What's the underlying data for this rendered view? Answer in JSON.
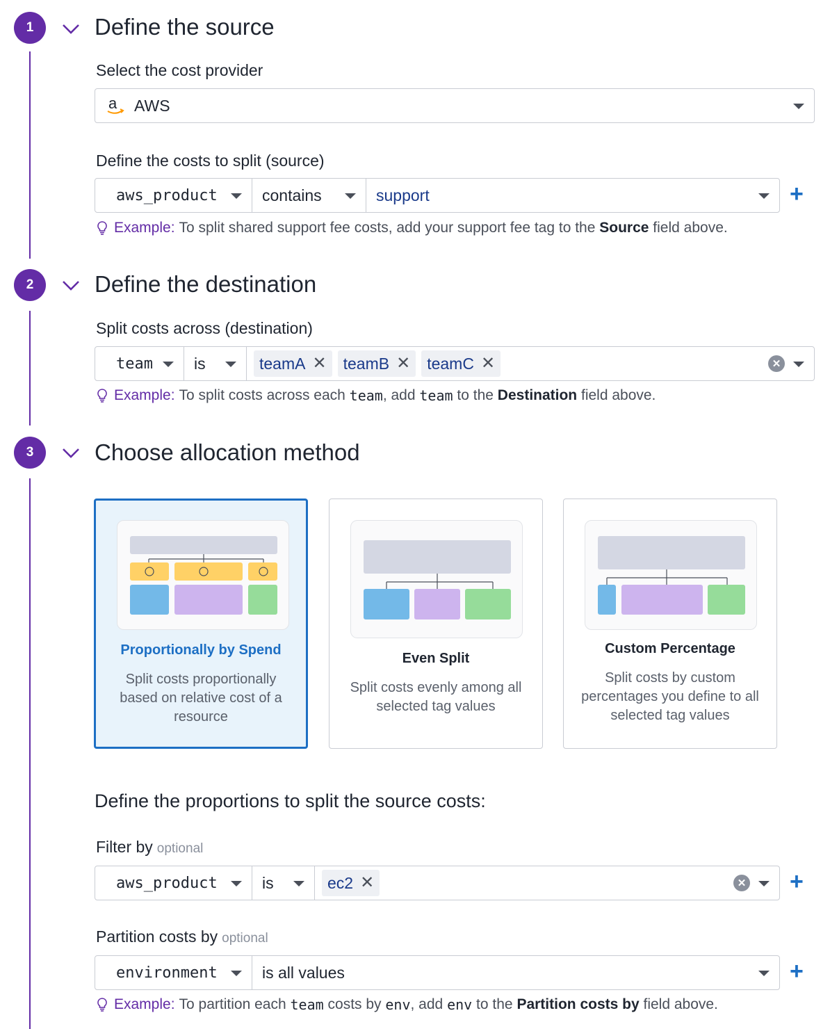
{
  "steps": [
    {
      "number": "1",
      "title": "Define the source"
    },
    {
      "number": "2",
      "title": "Define the destination"
    },
    {
      "number": "3",
      "title": "Choose allocation method"
    }
  ],
  "source": {
    "provider_label": "Select the cost provider",
    "provider_value": "AWS",
    "provider_icon": "amazon-logo",
    "costs_label": "Define the costs to split (source)",
    "tag_key": "aws_product",
    "operator": "contains",
    "value": "support",
    "hint": {
      "example": "Example:",
      "text_before": "To split shared support fee costs, add your support fee tag to the",
      "bold": "Source",
      "text_after": "field above."
    }
  },
  "destination": {
    "label": "Split costs across (destination)",
    "tag_key": "team",
    "operator": "is",
    "chips": [
      "teamA",
      "teamB",
      "teamC"
    ],
    "hint": {
      "example": "Example:",
      "t1": "To split costs across each",
      "code1": "team",
      "t2": ", add",
      "code2": "team",
      "t3": "to the",
      "bold": "Destination",
      "t4": "field above."
    }
  },
  "allocation": {
    "cards": [
      {
        "title": "Proportionally by Spend",
        "desc": "Split costs proportionally based on relative cost of a resource",
        "selected": true
      },
      {
        "title": "Even Split",
        "desc": "Split costs evenly among all selected tag values",
        "selected": false
      },
      {
        "title": "Custom Percentage",
        "desc": "Split costs by custom percentages you define to all selected tag values",
        "selected": false
      }
    ],
    "proportions_heading": "Define the proportions to split the source costs:",
    "filter": {
      "label": "Filter by",
      "optional": "optional",
      "tag_key": "aws_product",
      "operator": "is",
      "chips": [
        "ec2"
      ]
    },
    "partition": {
      "label": "Partition costs by",
      "optional": "optional",
      "tag_key": "environment",
      "operator": "is all values",
      "hint": {
        "example": "Example:",
        "t1": "To partition each",
        "code1": "team",
        "t2": "costs by",
        "code2": "env",
        "t3": ", add",
        "code3": "env",
        "t4": "to the",
        "bold": "Partition costs by",
        "t5": "field above."
      }
    }
  },
  "colors": {
    "accent": "#632ca6",
    "selected_blue": "#1d6fc4",
    "bar_grey": "#d4d7e3",
    "blue": "#73b9e8",
    "purple": "#cdb4ee",
    "green": "#96dc9a",
    "yellow": "#ffd166"
  }
}
